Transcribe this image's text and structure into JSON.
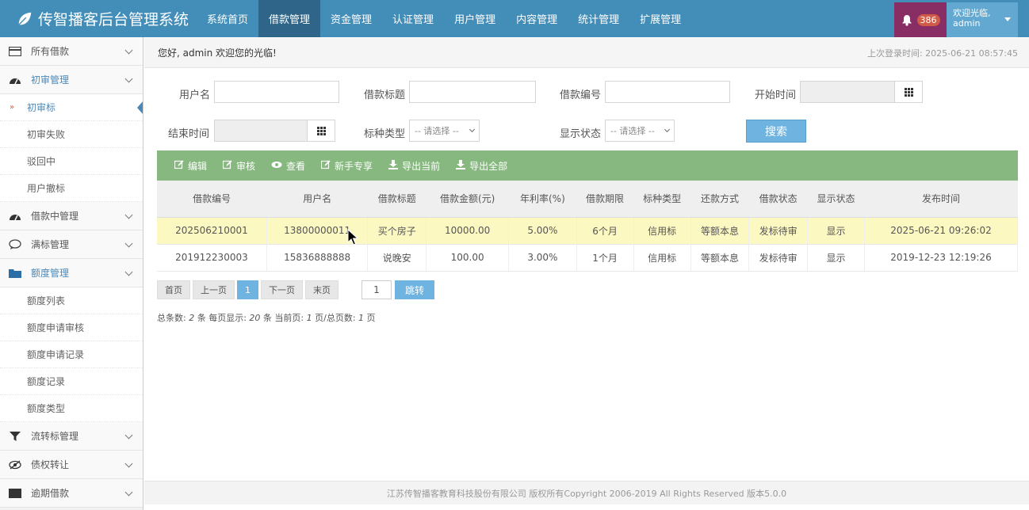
{
  "app": {
    "title": "传智播客后台管理系统"
  },
  "nav": [
    {
      "label": "系统首页"
    },
    {
      "label": "借款管理",
      "active": true
    },
    {
      "label": "资金管理"
    },
    {
      "label": "认证管理"
    },
    {
      "label": "用户管理"
    },
    {
      "label": "内容管理"
    },
    {
      "label": "统计管理"
    },
    {
      "label": "扩展管理"
    }
  ],
  "header": {
    "notification_count": "386",
    "welcome": "欢迎光临,",
    "username": "admin"
  },
  "sidebar": {
    "items": [
      {
        "label": "所有借款",
        "icon": "credit-card-icon"
      },
      {
        "label": "初审管理",
        "icon": "dashboard-icon",
        "open": true,
        "children": [
          "初审标",
          "初审失败",
          "驳回中",
          "用户撤标"
        ]
      },
      {
        "label": "借款中管理",
        "icon": "dashboard-icon"
      },
      {
        "label": "满标管理",
        "icon": "chat-icon"
      },
      {
        "label": "额度管理",
        "icon": "folder-icon",
        "open": true,
        "children": [
          "额度列表",
          "额度申请审核",
          "额度申请记录",
          "额度记录",
          "额度类型"
        ]
      },
      {
        "label": "流转标管理",
        "icon": "filter-icon"
      },
      {
        "label": "债权转让",
        "icon": "eye-slash-icon"
      },
      {
        "label": "逾期借款",
        "icon": "table-icon"
      }
    ]
  },
  "breadcrumb": {
    "greeting": "您好,  admin  欢迎您的光临!",
    "last_login": "上次登录时间: 2025-06-21 08:57:45"
  },
  "filters": {
    "username_label": "用户名",
    "title_label": "借款标题",
    "loan_no_label": "借款编号",
    "start_label": "开始时间",
    "end_label": "结束时间",
    "type_label": "标种类型",
    "type_value": "-- 请选择 --",
    "display_label": "显示状态",
    "display_value": "-- 请选择 --",
    "search_label": "搜索"
  },
  "toolbar": [
    {
      "label": "编辑",
      "icon": "edit-icon"
    },
    {
      "label": "审核",
      "icon": "edit-icon"
    },
    {
      "label": "查看",
      "icon": "eye-icon"
    },
    {
      "label": "新手专享",
      "icon": "edit-icon"
    },
    {
      "label": "导出当前",
      "icon": "download-icon"
    },
    {
      "label": "导出全部",
      "icon": "download-icon"
    }
  ],
  "table": {
    "headers": [
      "借款编号",
      "用户名",
      "借款标题",
      "借款金额(元)",
      "年利率(%)",
      "借款期限",
      "标种类型",
      "还款方式",
      "借款状态",
      "显示状态",
      "发布时间"
    ],
    "rows": [
      [
        "202506210001",
        "13800000011",
        "买个房子",
        "10000.00",
        "5.00%",
        "6个月",
        "信用标",
        "等额本息",
        "发标待审",
        "显示",
        "2025-06-21 09:26:02"
      ],
      [
        "201912230003",
        "15836888888",
        "说晚安",
        "100.00",
        "3.00%",
        "1个月",
        "信用标",
        "等额本息",
        "发标待审",
        "显示",
        "2019-12-23 12:19:26"
      ]
    ]
  },
  "pager": {
    "first": "首页",
    "prev": "上一页",
    "current": "1",
    "next": "下一页",
    "last": "末页",
    "page_input": "1",
    "jump": "跳转"
  },
  "summary": {
    "total_label": "总条数:",
    "total": "2",
    "per_label": "条 每页显示:",
    "per": "20",
    "cur_label": "条 当前页:",
    "cur": "1",
    "pages_label": "页/总页数:",
    "pages": "1",
    "tail": "页"
  },
  "footer": "江苏传智播客教育科技股份有限公司 版权所有Copyright 2006-2019 All Rights Reserved 版本5.0.0"
}
